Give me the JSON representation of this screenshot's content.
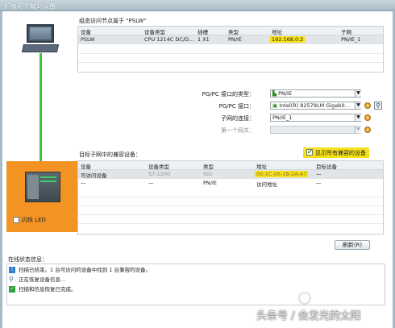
{
  "window": {
    "title": "扩展的下载到设备"
  },
  "upper": {
    "caption": "组态访问节点属于 \"PSLW\"",
    "headers": [
      "设备",
      "设备类型",
      "插槽",
      "类型",
      "地址",
      "子网"
    ],
    "row": [
      "PSLW",
      "CPU 1214C DC/D...",
      "1 X1",
      "PN/IE",
      "192.168.0.2",
      "PN/IE_1"
    ]
  },
  "form": {
    "pgpc_type_label": "PG/PC 接口的类型：",
    "pgpc_type_value": "PN/IE",
    "pgpc_if_label": "PG/PC 接口：",
    "pgpc_if_value": "Intel(R) 82579LM Gigabit...",
    "subnet_label": "子网的连接：",
    "subnet_value": "PN/IE_1",
    "gateway_label": "第一个网关：",
    "gateway_value": ""
  },
  "lower": {
    "caption": "目标子网中的兼容设备：",
    "show_all_label": "显示所有兼容的设备",
    "show_all_checked": true,
    "headers": [
      "设备",
      "设备类型",
      "类型",
      "地址",
      "目标设备"
    ],
    "rows": [
      [
        "可访问设备",
        "S7-1200",
        "ISO",
        "00-1C-06-1B-2A-A7",
        "—"
      ],
      [
        "—",
        "—",
        "PN/IE",
        "访问地址",
        "—"
      ]
    ]
  },
  "device": {
    "flash_led_label": "闪烁 LED",
    "flash_led_checked": false
  },
  "refresh_label": "刷新(R)",
  "status": {
    "caption": "在线状态信息：",
    "lines": [
      {
        "icon": "info-icon",
        "text": "扫描已结束。1 台可访问的设备中找到 1 台兼容的设备。"
      },
      {
        "icon": "search-icon",
        "text": "正在恢复设备信息..."
      },
      {
        "icon": "check-icon",
        "text": "扫描和信息恢复已完成。"
      }
    ]
  },
  "watermark": "头条号 / 会发光的太阳",
  "colors": {
    "accent_green": "#3cc43c",
    "device_bg": "#f39323",
    "highlight": "#f5e11a"
  }
}
